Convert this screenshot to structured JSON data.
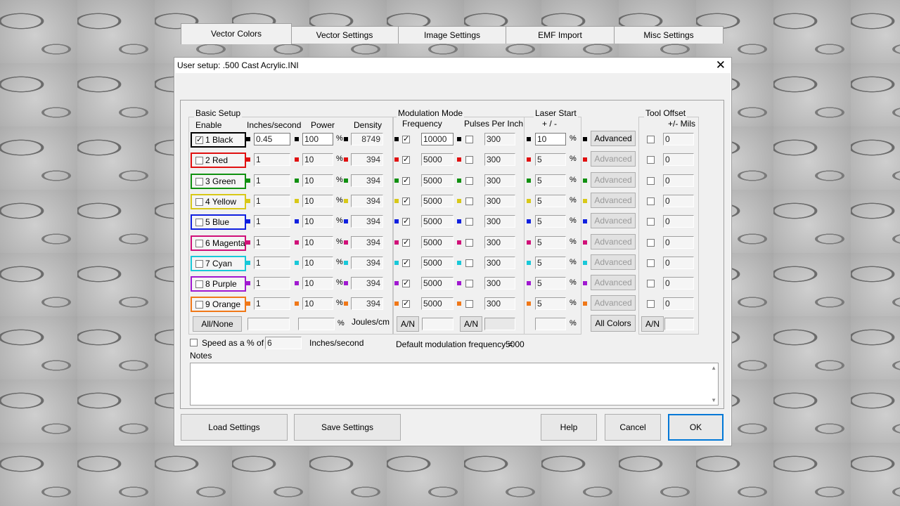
{
  "window": {
    "title": "User setup: .500 Cast Acrylic.INI",
    "close_glyph": "✕"
  },
  "tabs": [
    "Vector Colors",
    "Vector Settings",
    "Image Settings",
    "EMF Import",
    "Misc Settings"
  ],
  "groups": {
    "basic_setup": "Basic Setup",
    "modulation_mode": "Modulation Mode",
    "laser_start": "Laser Start",
    "tool_offset": "Tool Offset"
  },
  "headers": {
    "enable": "Enable",
    "speed": "Inches/second",
    "power": "Power",
    "density": "Density",
    "frequency": "Frequency",
    "ppi": "Pulses Per Inch",
    "laser_start_sub": "+ / -",
    "tool_offset_sub": "+/- Mils"
  },
  "rows": [
    {
      "name": "1 Black",
      "color": "#000000",
      "enabled": "✓",
      "speed": "0.45",
      "power": "100",
      "density": "8749",
      "freq": "10000",
      "mod": "✓",
      "ppi": "300",
      "laser_start": "10",
      "offset": "0",
      "advanced": "Advanced"
    },
    {
      "name": "2 Red",
      "color": "#e01010",
      "enabled": "",
      "speed": "1",
      "power": "10",
      "density": "394",
      "freq": "5000",
      "mod": "✓",
      "ppi": "300",
      "laser_start": "5",
      "offset": "0",
      "advanced": "Advanced"
    },
    {
      "name": "3 Green",
      "color": "#109010",
      "enabled": "",
      "speed": "1",
      "power": "10",
      "density": "394",
      "freq": "5000",
      "mod": "✓",
      "ppi": "300",
      "laser_start": "5",
      "offset": "0",
      "advanced": "Advanced"
    },
    {
      "name": "4 Yellow",
      "color": "#d8c818",
      "enabled": "",
      "speed": "1",
      "power": "10",
      "density": "394",
      "freq": "5000",
      "mod": "✓",
      "ppi": "300",
      "laser_start": "5",
      "offset": "0",
      "advanced": "Advanced"
    },
    {
      "name": "5 Blue",
      "color": "#1020e0",
      "enabled": "",
      "speed": "1",
      "power": "10",
      "density": "394",
      "freq": "5000",
      "mod": "✓",
      "ppi": "300",
      "laser_start": "5",
      "offset": "0",
      "advanced": "Advanced"
    },
    {
      "name": "6 Magenta",
      "color": "#d01078",
      "enabled": "",
      "speed": "1",
      "power": "10",
      "density": "394",
      "freq": "5000",
      "mod": "✓",
      "ppi": "300",
      "laser_start": "5",
      "offset": "0",
      "advanced": "Advanced"
    },
    {
      "name": "7 Cyan",
      "color": "#18c8d8",
      "enabled": "",
      "speed": "1",
      "power": "10",
      "density": "394",
      "freq": "5000",
      "mod": "✓",
      "ppi": "300",
      "laser_start": "5",
      "offset": "0",
      "advanced": "Advanced"
    },
    {
      "name": "8 Purple",
      "color": "#a018d0",
      "enabled": "",
      "speed": "1",
      "power": "10",
      "density": "394",
      "freq": "5000",
      "mod": "✓",
      "ppi": "300",
      "laser_start": "5",
      "offset": "0",
      "advanced": "Advanced"
    },
    {
      "name": "9 Orange",
      "color": "#f07818",
      "enabled": "",
      "speed": "1",
      "power": "10",
      "density": "394",
      "freq": "5000",
      "mod": "✓",
      "ppi": "300",
      "laser_start": "5",
      "offset": "0",
      "advanced": "Advanced"
    }
  ],
  "bottom_row": {
    "all_none": "All/None",
    "pct": "%",
    "joules": "Joules/cm",
    "an": "A/N",
    "all_colors": "All Colors"
  },
  "speed_pct": {
    "label": "Speed as a % of",
    "value": "6",
    "unit": "Inches/second"
  },
  "default_mod": {
    "label": "Default modulation frequency =",
    "value": "5000"
  },
  "notes_label": "Notes",
  "buttons": {
    "load": "Load Settings",
    "save": "Save Settings",
    "help": "Help",
    "cancel": "Cancel",
    "ok": "OK"
  }
}
